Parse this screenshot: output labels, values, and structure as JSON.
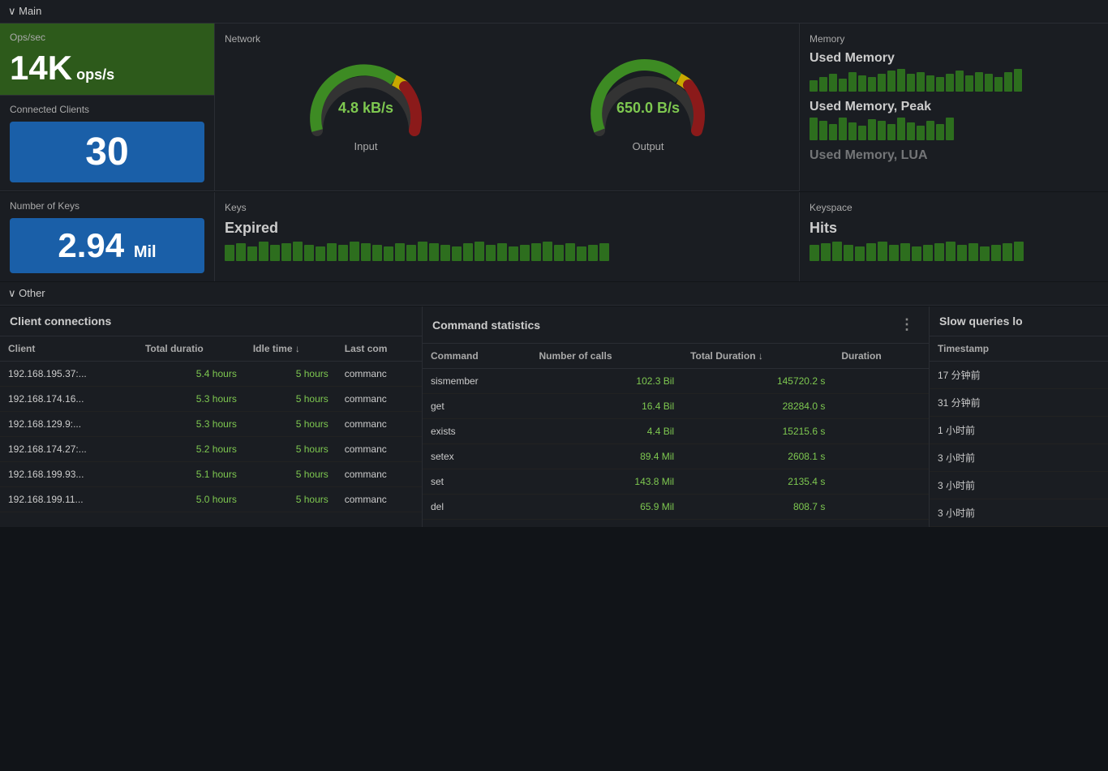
{
  "main_section": {
    "label": "∨ Main",
    "ops": {
      "label": "Ops/sec",
      "value": "14K",
      "unit": "ops/s"
    },
    "clients": {
      "label": "Connected Clients",
      "value": "30"
    },
    "keys_count": {
      "label": "Number of Keys",
      "value": "2.94",
      "unit": "Mil"
    },
    "network": {
      "label": "Network",
      "input": {
        "value": "4.8 kB/s",
        "label": "Input"
      },
      "output": {
        "value": "650.0 B/s",
        "label": "Output"
      }
    },
    "memory": {
      "label": "Memory",
      "items": [
        {
          "label": "Used Memory"
        },
        {
          "label": "Used Memory, Peak"
        },
        {
          "label": "Used Memory, LUA"
        }
      ]
    },
    "keys": {
      "label": "Keys",
      "items": [
        {
          "label": "Expired"
        }
      ]
    },
    "keyspace": {
      "label": "Keyspace",
      "items": [
        {
          "label": "Hits"
        }
      ]
    }
  },
  "other_section": {
    "label": "∨ Other"
  },
  "client_connections": {
    "title": "Client connections",
    "columns": [
      "Client",
      "Total duratio",
      "Idle time ↓",
      "Last com"
    ],
    "rows": [
      {
        "client": "192.168.195.37:...",
        "total": "5.4 hours",
        "idle": "5 hours",
        "last": "commanc"
      },
      {
        "client": "192.168.174.16...",
        "total": "5.3 hours",
        "idle": "5 hours",
        "last": "commanc"
      },
      {
        "client": "192.168.129.9:...",
        "total": "5.3 hours",
        "idle": "5 hours",
        "last": "commanc"
      },
      {
        "client": "192.168.174.27:...",
        "total": "5.2 hours",
        "idle": "5 hours",
        "last": "commanc"
      },
      {
        "client": "192.168.199.93...",
        "total": "5.1 hours",
        "idle": "5 hours",
        "last": "commanc"
      },
      {
        "client": "192.168.199.11...",
        "total": "5.0 hours",
        "idle": "5 hours",
        "last": "commanc"
      }
    ]
  },
  "command_stats": {
    "title": "Command statistics",
    "columns": [
      "Command",
      "Number of calls",
      "Total Duration ↓",
      "Duration"
    ],
    "rows": [
      {
        "command": "sismember",
        "calls": "102.3 Bil",
        "total_dur": "145720.2 s",
        "duration": ""
      },
      {
        "command": "get",
        "calls": "16.4 Bil",
        "total_dur": "28284.0 s",
        "duration": ""
      },
      {
        "command": "exists",
        "calls": "4.4 Bil",
        "total_dur": "15215.6 s",
        "duration": ""
      },
      {
        "command": "setex",
        "calls": "89.4 Mil",
        "total_dur": "2608.1 s",
        "duration": ""
      },
      {
        "command": "set",
        "calls": "143.8 Mil",
        "total_dur": "2135.4 s",
        "duration": ""
      },
      {
        "command": "del",
        "calls": "65.9 Mil",
        "total_dur": "808.7 s",
        "duration": ""
      }
    ]
  },
  "slow_queries": {
    "title": "Slow queries lo",
    "columns": [
      "Timestamp"
    ],
    "rows": [
      {
        "ts": "17 分钟前"
      },
      {
        "ts": "31 分钟前"
      },
      {
        "ts": "1 小时前"
      },
      {
        "ts": "3 小时前"
      },
      {
        "ts": "3 小时前"
      },
      {
        "ts": "3 小时前"
      }
    ]
  }
}
